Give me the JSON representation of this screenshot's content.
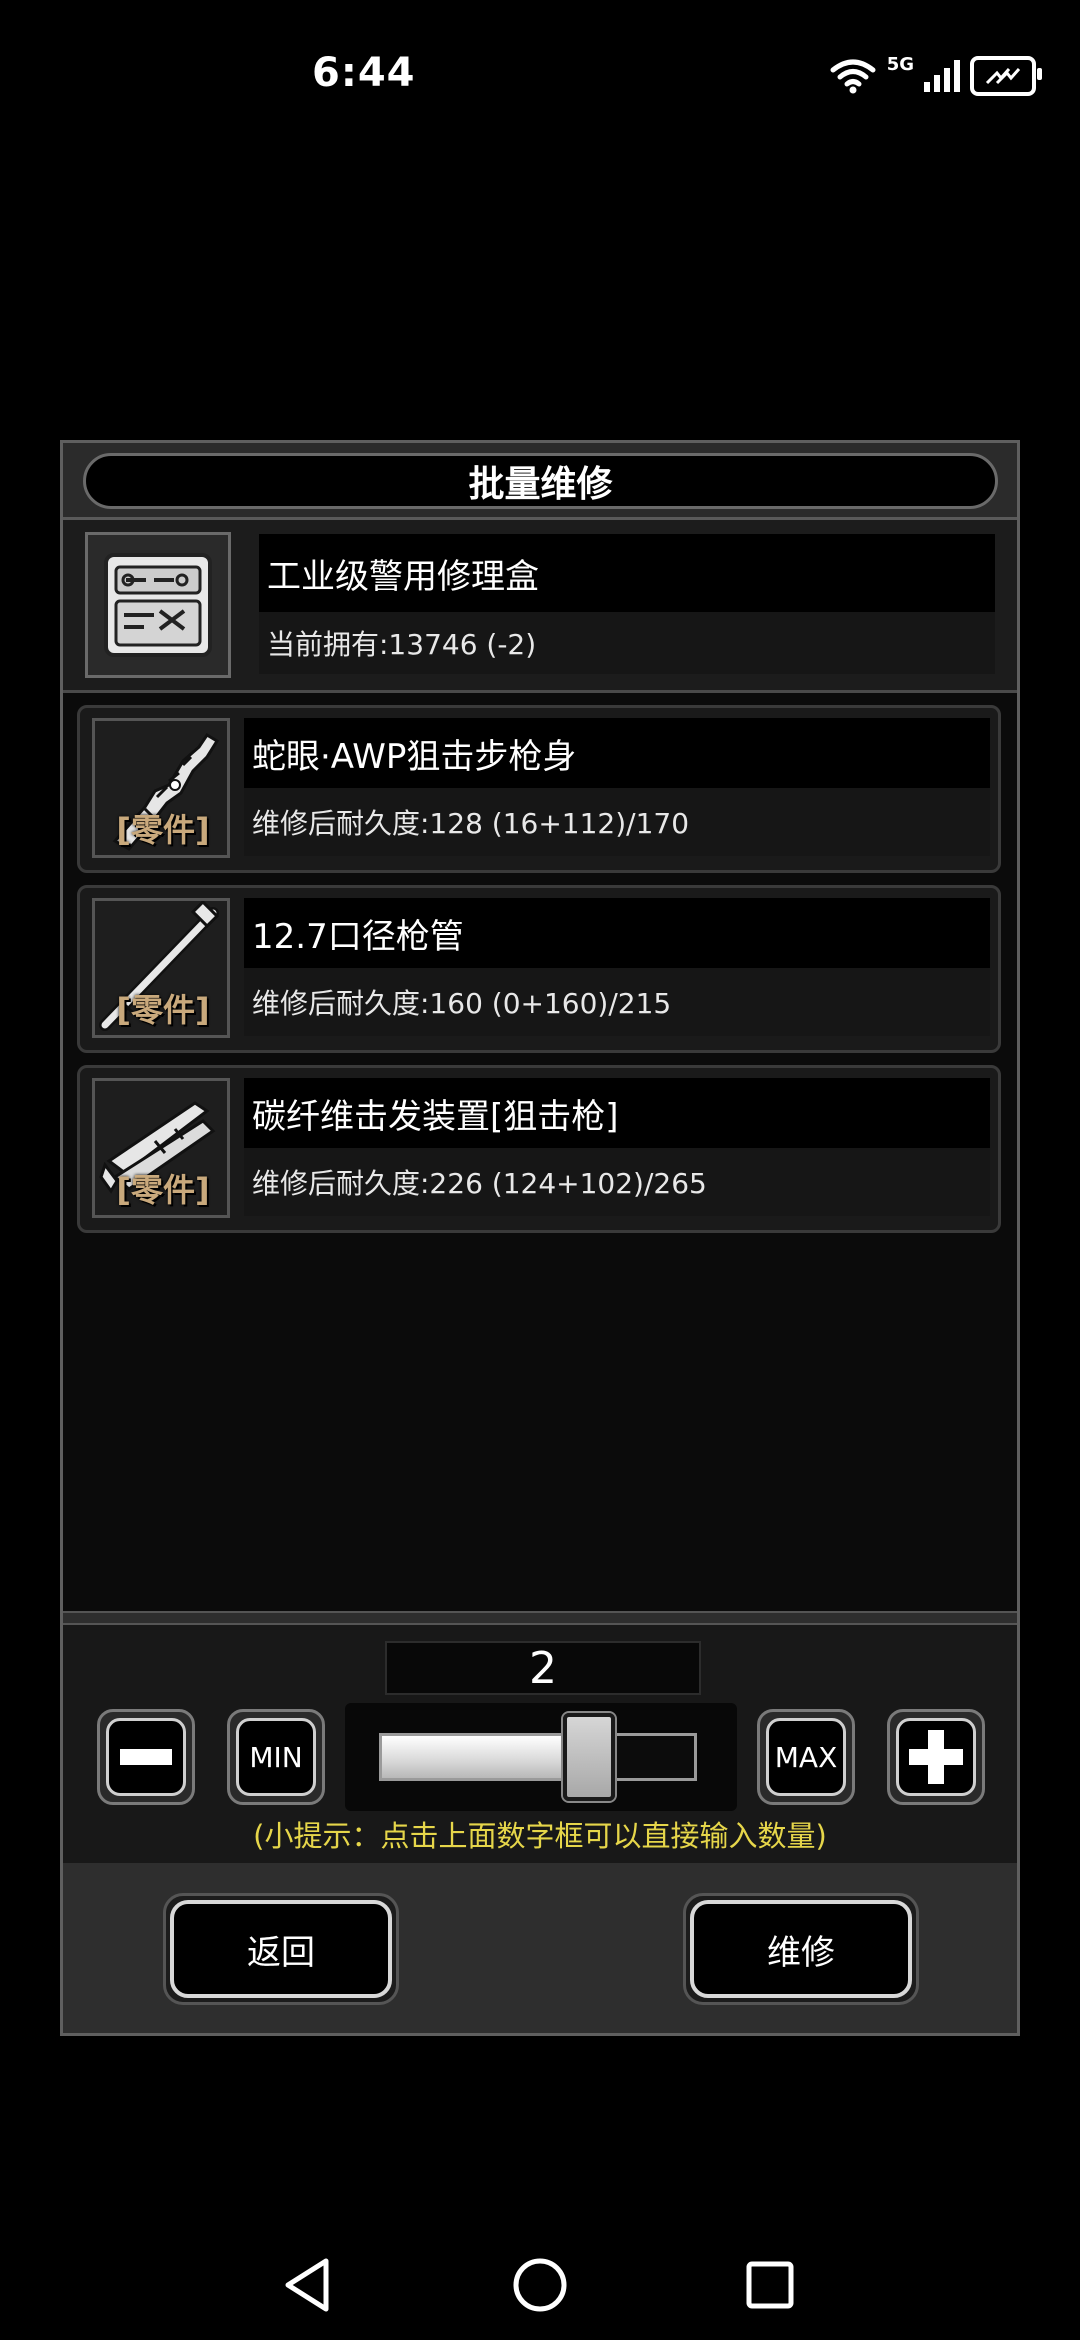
{
  "status": {
    "time": "6:44",
    "network": "5G"
  },
  "dialog": {
    "title": "批量维修",
    "tool": {
      "name": "工业级警用修理盒",
      "owned": "当前拥有:13746 (-2)"
    },
    "parts": [
      {
        "tag": "零件",
        "name": "蛇眼·AWP狙击步枪身",
        "durability": "维修后耐久度:128 (16+112)/170",
        "icon": "rifle-body-icon"
      },
      {
        "tag": "零件",
        "name": "12.7口径枪管",
        "durability": "维修后耐久度:160 (0+160)/215",
        "icon": "barrel-icon"
      },
      {
        "tag": "零件",
        "name": "碳纤维击发装置[狙击枪]",
        "durability": "维修后耐久度:226 (124+102)/265",
        "icon": "firing-mechanism-icon"
      }
    ],
    "quantity": {
      "value": "2",
      "min_label": "MIN",
      "max_label": "MAX",
      "slider_fraction": 0.66,
      "hint": "(小提示：点击上面数字框可以直接输入数量)"
    },
    "buttons": {
      "back": "返回",
      "repair": "维修"
    }
  }
}
